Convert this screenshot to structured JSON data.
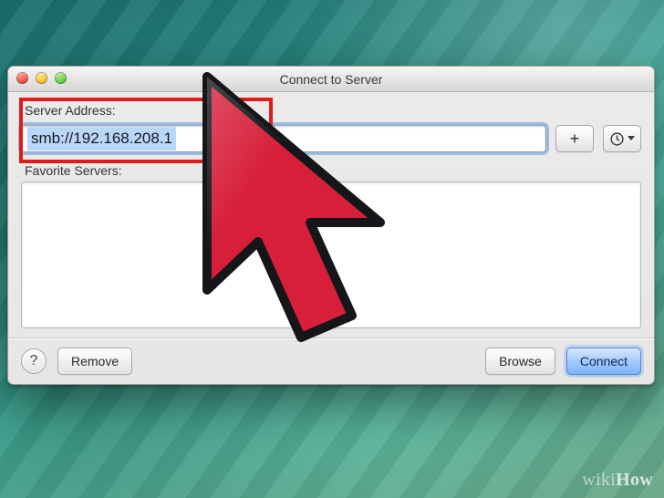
{
  "window": {
    "title": "Connect to Server",
    "server_address_label": "Server Address:",
    "server_address_value": "smb://192.168.208.1",
    "favorite_servers_label": "Favorite Servers:",
    "buttons": {
      "add_label": "+",
      "remove_label": "Remove",
      "browse_label": "Browse",
      "connect_label": "Connect",
      "help_label": "?"
    }
  },
  "overlay": {
    "highlight_color": "#e11a1a",
    "arrow_fill": "#d71f3a",
    "arrow_stroke": "#111318"
  },
  "watermark": {
    "brand_prefix": "wiki",
    "brand_suffix": "How"
  }
}
